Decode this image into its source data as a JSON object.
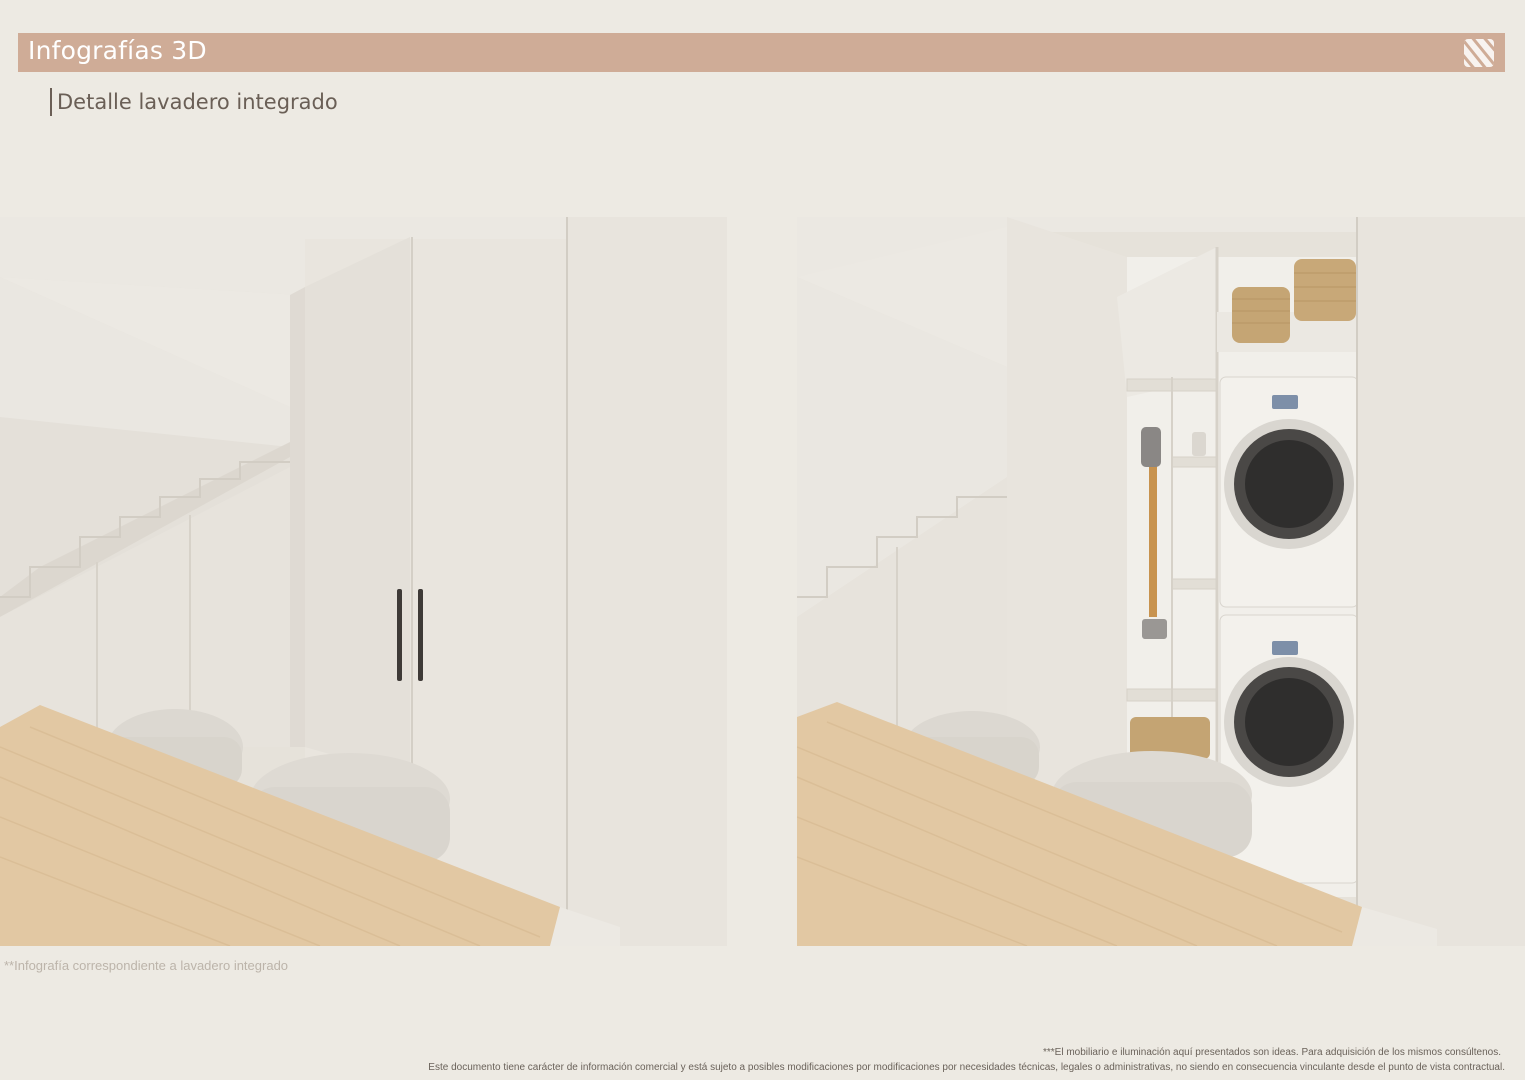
{
  "header": {
    "title": "Infografías 3D",
    "logo_icon": "diagonal-stripes-logo-icon",
    "bar_color": "#cfac97"
  },
  "section": {
    "subtitle": "Detalle lavadero integrado"
  },
  "images": [
    {
      "name": "render-closed-cabinet",
      "icon": "render-image"
    },
    {
      "name": "render-open-laundry",
      "icon": "render-image"
    }
  ],
  "caption": "**Infografía correspondiente a lavadero integrado",
  "footnotes": {
    "furniture_note": "***El mobiliario e iluminación aquí presentados son ideas. Para adquisición de los mismos consúltenos.",
    "legal_note": "Este documento tiene carácter de información comercial y está sujeto a posibles modificaciones por modificaciones por necesidades técnicas, legales o administrativas, no siendo en consecuencia vinculante desde el punto de vista contractual."
  }
}
